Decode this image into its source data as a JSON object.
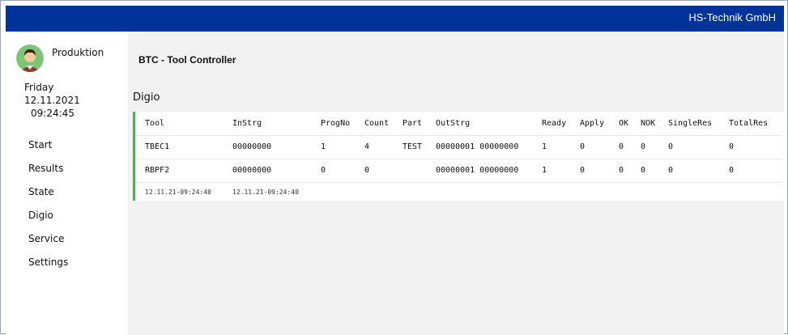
{
  "header": {
    "brand": "HS-Technik GmbH"
  },
  "sidebar": {
    "user": "Produktion",
    "day": "Friday",
    "date": "12.11.2021",
    "time": "09:24:45",
    "nav": [
      {
        "label": "Start"
      },
      {
        "label": "Results"
      },
      {
        "label": "State"
      },
      {
        "label": "Digio"
      },
      {
        "label": "Service"
      },
      {
        "label": "Settings"
      }
    ]
  },
  "main": {
    "title": "BTC - Tool Controller",
    "section": "Digio",
    "table": {
      "columns": [
        "Tool",
        "InStrg",
        "ProgNo",
        "Count",
        "Part",
        "OutStrg",
        "Ready",
        "Apply",
        "OK",
        "NOK",
        "SingleRes",
        "TotalRes"
      ],
      "rows": [
        [
          "TBEC1",
          "00000000",
          "1",
          "4",
          "TEST",
          "00000001 00000000",
          "1",
          "0",
          "0",
          "0",
          "0",
          "0"
        ],
        [
          "RBPF2",
          "00000000",
          "0",
          "0",
          "",
          "00000001 00000000",
          "1",
          "0",
          "0",
          "0",
          "0",
          "0"
        ]
      ],
      "footer": [
        "12.11.21-09:24:40",
        "12.11.21-09:24:40"
      ]
    }
  },
  "colors": {
    "topbar": "#003399",
    "accent": "#4caf50",
    "background": "#f2f2f2"
  },
  "icons": {
    "avatar": "user-avatar-icon"
  }
}
